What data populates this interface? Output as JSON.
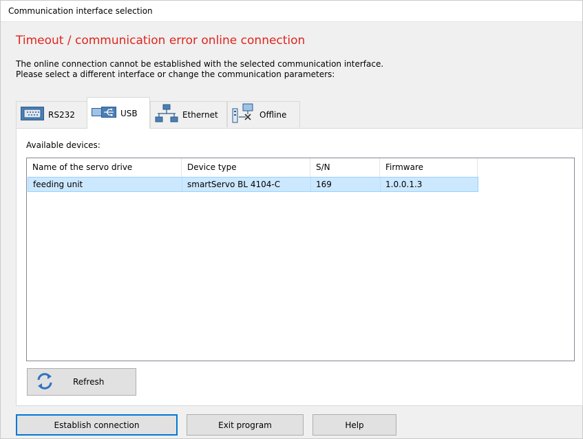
{
  "window": {
    "title": "Communication interface selection"
  },
  "message": {
    "heading": "Timeout / communication error online connection",
    "line1": "The online connection cannot be established with the selected communication interface.",
    "line2": "Please select a different interface or change the communication parameters:"
  },
  "tabs": [
    {
      "label": "RS232",
      "icon": "serial-port-icon",
      "active": false
    },
    {
      "label": "USB",
      "icon": "usb-icon",
      "active": true
    },
    {
      "label": "Ethernet",
      "icon": "network-icon",
      "active": false
    },
    {
      "label": "Offline",
      "icon": "offline-icon",
      "active": false
    }
  ],
  "devices": {
    "label": "Available devices:",
    "columns": [
      "Name of the servo drive",
      "Device type",
      "S/N",
      "Firmware"
    ],
    "rows": [
      {
        "name": "feeding unit",
        "type": "smartServo BL 4104-C",
        "sn": "169",
        "firmware": "1.0.0.1.3",
        "selected": true
      }
    ]
  },
  "refresh": {
    "label": "Refresh",
    "icon": "refresh-icon"
  },
  "buttons": {
    "establish": "Establish connection",
    "exit": "Exit program",
    "help": "Help"
  },
  "colors": {
    "heading": "#e0241c",
    "selection": "#cce8ff",
    "accent": "#0078d7"
  }
}
